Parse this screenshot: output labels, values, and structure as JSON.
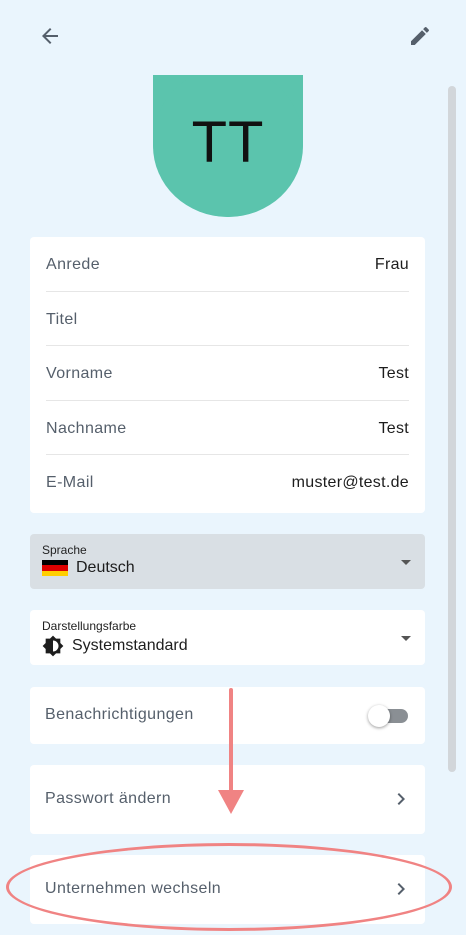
{
  "avatar": {
    "initials": "TT",
    "color": "#5bc4ad"
  },
  "profile": {
    "rows": [
      {
        "label": "Anrede",
        "value": "Frau"
      },
      {
        "label": "Titel",
        "value": ""
      },
      {
        "label": "Vorname",
        "value": "Test"
      },
      {
        "label": "Nachname",
        "value": "Test"
      },
      {
        "label": "E-Mail",
        "value": "muster@test.de"
      }
    ]
  },
  "language": {
    "label": "Sprache",
    "value": "Deutsch",
    "flag": "german-flag-icon"
  },
  "theme": {
    "label": "Darstellungsfarbe",
    "value": "Systemstandard",
    "icon": "brightness-auto-icon"
  },
  "notifications": {
    "label": "Benachrichtigungen",
    "enabled": false
  },
  "password": {
    "label": "Passwort ändern"
  },
  "company": {
    "label": "Unternehmen wechseln"
  },
  "colors": {
    "background": "#eaf5fd",
    "annotation": "#f08383",
    "selected_field": "#d9dfe4"
  }
}
